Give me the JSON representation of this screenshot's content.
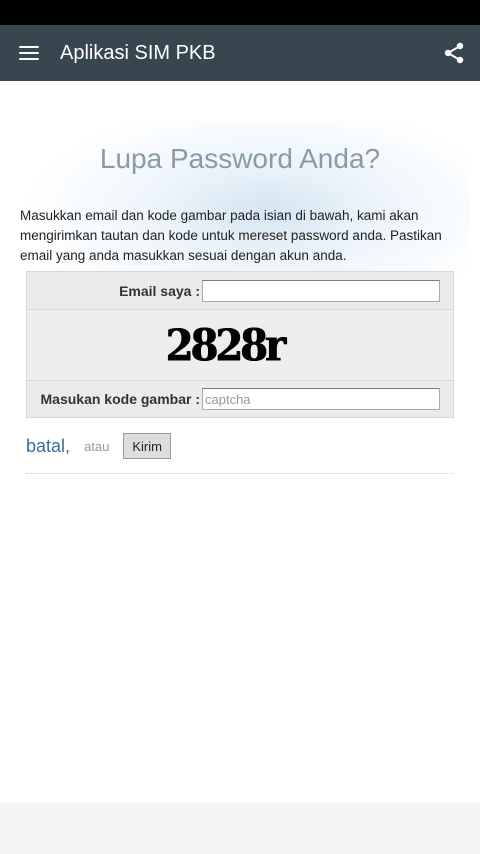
{
  "app_bar": {
    "title": "Aplikasi SIM PKB",
    "menu_icon": "hamburger-icon",
    "share_icon": "share-icon"
  },
  "page": {
    "title": "Lupa Password Anda?",
    "intro": "Masukkan email dan kode gambar pada isian di bawah, kami akan mengirimkan tautan dan kode untuk mereset password anda. Pastikan email yang anda masukkan sesuai dengan akun anda."
  },
  "form": {
    "email_label": "Email saya :",
    "email_value": "",
    "captcha_text": "2828r",
    "code_label": "Masukan kode gambar :",
    "code_placeholder": "captcha"
  },
  "actions": {
    "cancel_label": "batal",
    "comma": ",",
    "or_label": "atau",
    "submit_label": "Kirim"
  },
  "colors": {
    "app_bar": "#37474f",
    "title": "#8a9aa6",
    "link": "#3a6f9a"
  }
}
